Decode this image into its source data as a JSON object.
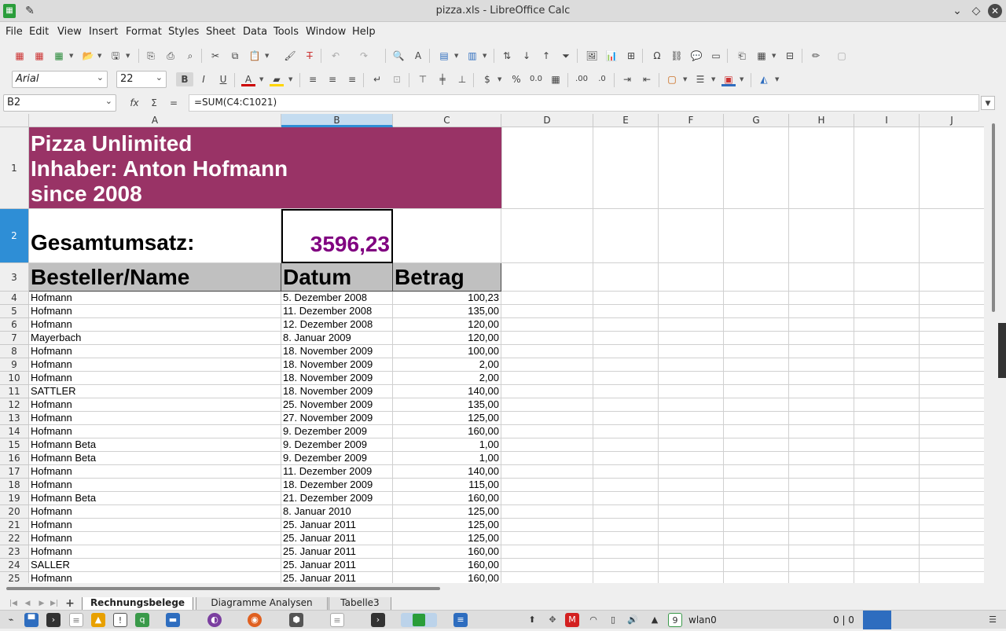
{
  "window": {
    "title": "pizza.xls - LibreOffice Calc"
  },
  "menu": [
    "File",
    "Edit",
    "View",
    "Insert",
    "Format",
    "Styles",
    "Sheet",
    "Data",
    "Tools",
    "Window",
    "Help"
  ],
  "format_bar": {
    "font_name": "Arial",
    "font_size": "22"
  },
  "formula_bar": {
    "cell_ref": "B2",
    "formula": "=SUM(C4:C1021)"
  },
  "columns": [
    "A",
    "B",
    "C",
    "D",
    "E",
    "F",
    "G",
    "H",
    "I",
    "J"
  ],
  "sheet": {
    "title_lines": [
      "Pizza Unlimited",
      "Inhaber: Anton Hofmann",
      "since 2008"
    ],
    "total_label": "Gesamtumsatz:",
    "total_value": "3596,23",
    "headers": [
      "Besteller/Name",
      "Datum",
      "Betrag"
    ],
    "rows": [
      {
        "n": "4",
        "name": "Hofmann",
        "date": "5. Dezember 2008",
        "amount": "100,23"
      },
      {
        "n": "5",
        "name": "Hofmann",
        "date": "11. Dezember 2008",
        "amount": "135,00"
      },
      {
        "n": "6",
        "name": "Hofmann",
        "date": "12. Dezember 2008",
        "amount": "120,00"
      },
      {
        "n": "7",
        "name": "Mayerbach",
        "date": "8. Januar 2009",
        "amount": "120,00"
      },
      {
        "n": "8",
        "name": "Hofmann",
        "date": "18. November 2009",
        "amount": "100,00"
      },
      {
        "n": "9",
        "name": "Hofmann",
        "date": "18. November 2009",
        "amount": "2,00"
      },
      {
        "n": "10",
        "name": "Hofmann",
        "date": "18. November 2009",
        "amount": "2,00"
      },
      {
        "n": "11",
        "name": "SATTLER",
        "date": "18. November 2009",
        "amount": "140,00"
      },
      {
        "n": "12",
        "name": "Hofmann",
        "date": "25. November 2009",
        "amount": "135,00"
      },
      {
        "n": "13",
        "name": "Hofmann",
        "date": "27. November 2009",
        "amount": "125,00"
      },
      {
        "n": "14",
        "name": "Hofmann",
        "date": "9. Dezember 2009",
        "amount": "160,00"
      },
      {
        "n": "15",
        "name": "Hofmann Beta",
        "date": "9. Dezember 2009",
        "amount": "1,00"
      },
      {
        "n": "16",
        "name": "Hofmann Beta",
        "date": "9. Dezember 2009",
        "amount": "1,00"
      },
      {
        "n": "17",
        "name": "Hofmann",
        "date": "11. Dezember 2009",
        "amount": "140,00"
      },
      {
        "n": "18",
        "name": "Hofmann",
        "date": "18. Dezember 2009",
        "amount": "115,00"
      },
      {
        "n": "19",
        "name": "Hofmann Beta",
        "date": "21. Dezember 2009",
        "amount": "160,00"
      },
      {
        "n": "20",
        "name": "Hofmann",
        "date": "8. Januar 2010",
        "amount": "125,00"
      },
      {
        "n": "21",
        "name": "Hofmann",
        "date": "25. Januar 2011",
        "amount": "125,00"
      },
      {
        "n": "22",
        "name": "Hofmann",
        "date": "25. Januar 2011",
        "amount": "125,00"
      },
      {
        "n": "23",
        "name": "Hofmann",
        "date": "25. Januar 2011",
        "amount": "160,00"
      },
      {
        "n": "24",
        "name": "SALLER",
        "date": "25. Januar 2011",
        "amount": "160,00"
      },
      {
        "n": "25",
        "name": "Hofmann",
        "date": "25. Januar 2011",
        "amount": "160,00"
      }
    ]
  },
  "sheet_tabs": [
    "Rechnungsbelege",
    "Diagramme Analysen",
    "Tabelle3"
  ],
  "taskbar": {
    "network_label": "wlan0",
    "counter": "0 | 0",
    "badge": "9"
  },
  "colors": {
    "title_bg": "#993366",
    "total_fg": "#800080",
    "header_bg": "#c0c0c0"
  }
}
